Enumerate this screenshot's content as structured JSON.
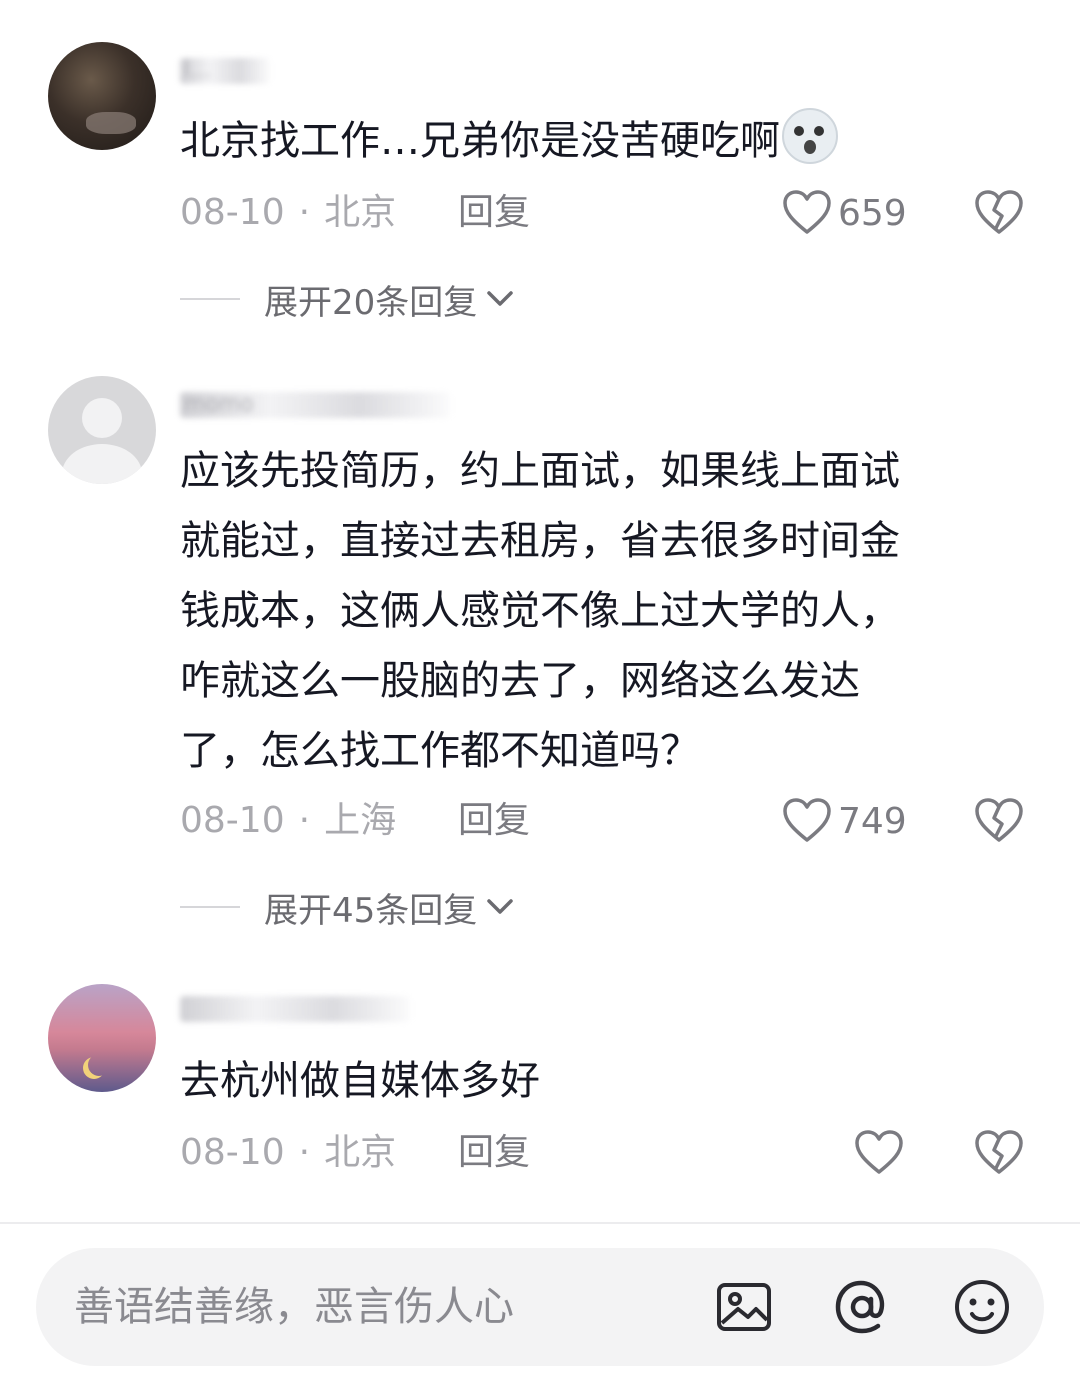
{
  "comments": [
    {
      "username_blurred": "l...",
      "text": "北京找工作…兄弟你是没苦硬吃啊",
      "date": "08-10",
      "location": "北京",
      "reply_label": "回复",
      "likes": "659",
      "expand_label": "展开20条回复"
    },
    {
      "username_blurred": "momo",
      "text": "应该先投简历，约上面试，如果线上面试\n就能过，直接过去租房，省去很多时间金\n钱成本，这俩人感觉不像上过大学的人，\n咋就这么一股脑的去了，网络这么发达\n了，怎么找工作都不知道吗？",
      "date": "08-10",
      "location": "上海",
      "reply_label": "回复",
      "likes": "749",
      "expand_label": "展开45条回复"
    },
    {
      "username_blurred": "",
      "text": "去杭州做自媒体多好",
      "date": "08-10",
      "location": "北京",
      "reply_label": "回复",
      "likes": ""
    }
  ],
  "input_bar": {
    "placeholder": "善语结善缘，恶言伤人心",
    "icons": [
      "image-icon",
      "at-icon",
      "emoji-icon"
    ]
  },
  "colors": {
    "text": "#161823",
    "meta": "#a9a9ae",
    "secondary": "#7b7b81",
    "input_bg": "#f3f3f4"
  }
}
